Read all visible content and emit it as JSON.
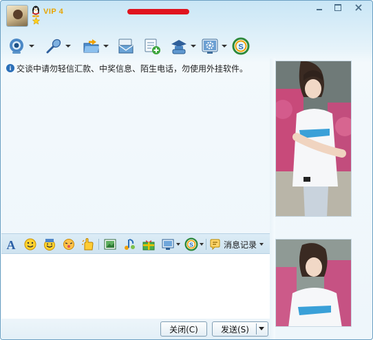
{
  "titlebar": {
    "vip_label": "VIP 4",
    "avatar_icon": "user-avatar",
    "qq_icon": "qq-penguin-icon",
    "star_icon": "star-icon",
    "window_controls": [
      "minimize-icon",
      "maximize-icon",
      "close-icon"
    ]
  },
  "toolbar": {
    "items": [
      {
        "icon": "webcam-icon",
        "has_dropdown": true
      },
      {
        "icon": "microphone-icon",
        "has_dropdown": true
      },
      {
        "icon": "folder-transfer-icon",
        "has_dropdown": true
      },
      {
        "icon": "email-icon",
        "has_dropdown": false
      },
      {
        "icon": "create-group-icon",
        "has_dropdown": false
      },
      {
        "icon": "app-share-icon",
        "has_dropdown": true
      },
      {
        "icon": "settings-icon",
        "has_dropdown": true
      },
      {
        "icon": "soso-icon",
        "has_dropdown": false
      }
    ]
  },
  "chat": {
    "notice": "交谈中请勿轻信汇款、中奖信息、陌生电话，勿使用外挂软件。"
  },
  "input_toolbar": {
    "items": [
      "font-icon",
      "emoticon-icon",
      "magic-emoticon-icon",
      "shake-icon",
      "vibrate-hand-icon",
      "image-icon",
      "music-icon",
      "gift-icon",
      "screenshot-icon",
      "soso-search-icon"
    ],
    "history_label": "消息记录"
  },
  "buttons": {
    "close_label": "关闭(C)",
    "send_label": "发送(S)"
  },
  "colors": {
    "vip": "#e8a400",
    "accent": "#2b6fb8",
    "redaction": "#e0141e"
  }
}
